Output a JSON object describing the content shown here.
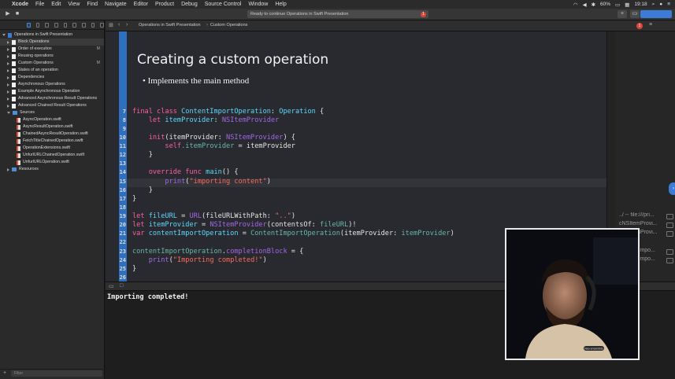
{
  "menubar": {
    "apple": "",
    "items": [
      "Xcode",
      "File",
      "Edit",
      "View",
      "Find",
      "Navigate",
      "Editor",
      "Product",
      "Debug",
      "Source Control",
      "Window",
      "Help"
    ],
    "battery": "60%",
    "clock": "19:18"
  },
  "toolbar": {
    "status": "Ready to continue Operations in Swift Presentation",
    "error_count": "1",
    "plus": "+"
  },
  "navigator": {
    "project": "Operations in Swift Presentation",
    "items": [
      {
        "label": "Block Operations",
        "flag": ""
      },
      {
        "label": "Order of execution",
        "flag": "M"
      },
      {
        "label": "Reusing operations",
        "flag": ""
      },
      {
        "label": "Custom Operations",
        "flag": "M"
      },
      {
        "label": "States of an operation",
        "flag": ""
      },
      {
        "label": "Dependencies",
        "flag": ""
      },
      {
        "label": "Asynchronous Operations",
        "flag": ""
      },
      {
        "label": "Example Asynchronous Operation",
        "flag": ""
      },
      {
        "label": "Advanced Asynchronous Result Operations",
        "flag": ""
      },
      {
        "label": "Advanced Chained Result Operations",
        "flag": ""
      }
    ],
    "sources_folder": "Sources",
    "sources": [
      "AsyncOperation.swift",
      "AsyncResultOperation.swift",
      "ChainedAsyncResultOperation.swift",
      "FetchTitleChainedOperation.swift",
      "OperationExtensions.swift",
      "UnfurlURLChainedOperation.swift",
      "UnfurlURLOperation.swift"
    ],
    "resources_folder": "Resources",
    "filter_placeholder": "Filter"
  },
  "jumpbar": {
    "crumb1": "Operations in Swift Presentation",
    "crumb2": "Custom Operations",
    "error_count": "1"
  },
  "slide": {
    "title": "Creating a custom operation",
    "bullet": "Implements the main method"
  },
  "code": {
    "line_numbers": [
      "7",
      "8",
      "9",
      "10",
      "11",
      "12",
      "13",
      "14",
      "15",
      "16",
      "17",
      "18",
      "19",
      "20",
      "21",
      "22",
      "23",
      "24",
      "25",
      "26"
    ],
    "lines": {
      "l7": [
        "final class ",
        "ContentImportOperation",
        ": ",
        "Operation",
        " {"
      ],
      "l8": [
        "    let ",
        "itemProvider",
        ": ",
        "NSItemProvider"
      ],
      "l10": [
        "    init",
        "(itemProvider: ",
        "NSItemProvider",
        ") {"
      ],
      "l11": [
        "        ",
        "self",
        ".itemProvider",
        " = itemProvider"
      ],
      "l12": "    }",
      "l14": [
        "    override func ",
        "main",
        "() {"
      ],
      "l15": [
        "        ",
        "print",
        "(",
        "\"importing content\"",
        ")"
      ],
      "l16": "    }",
      "l17": "}",
      "l19": [
        "let ",
        "fileURL",
        " = ",
        "URL",
        "(fileURLWithPath: ",
        "\"..\"",
        ")"
      ],
      "l20": [
        "let ",
        "itemProvider",
        " = ",
        "NSItemProvider",
        "(contentsOf: ",
        "fileURL",
        ")!"
      ],
      "l21": [
        "var ",
        "contentImportOperation",
        " = ",
        "ContentImportOperation",
        "(itemProvider: ",
        "itemProvider",
        ")"
      ],
      "l23": [
        "contentImportOperation",
        ".",
        "completionBlock",
        " = {"
      ],
      "l24": [
        "    ",
        "print",
        "(",
        "\"Importing completed!\"",
        ")"
      ],
      "l25": "}"
    }
  },
  "results": [
    "../ -- file:///pri...",
    "cNSItemProvi...",
    "cNSItemProvi...",
    "ContentImpo...",
    "ContentImpo..."
  ],
  "console": {
    "output": "Importing completed!"
  },
  "webcam": {
    "badge": "Nao-encendido"
  },
  "colors": {
    "keyword": "#fc5fa3",
    "type": "#5dd8ff",
    "string": "#fc6a5d",
    "slide_accent": "#2e6fbf"
  }
}
